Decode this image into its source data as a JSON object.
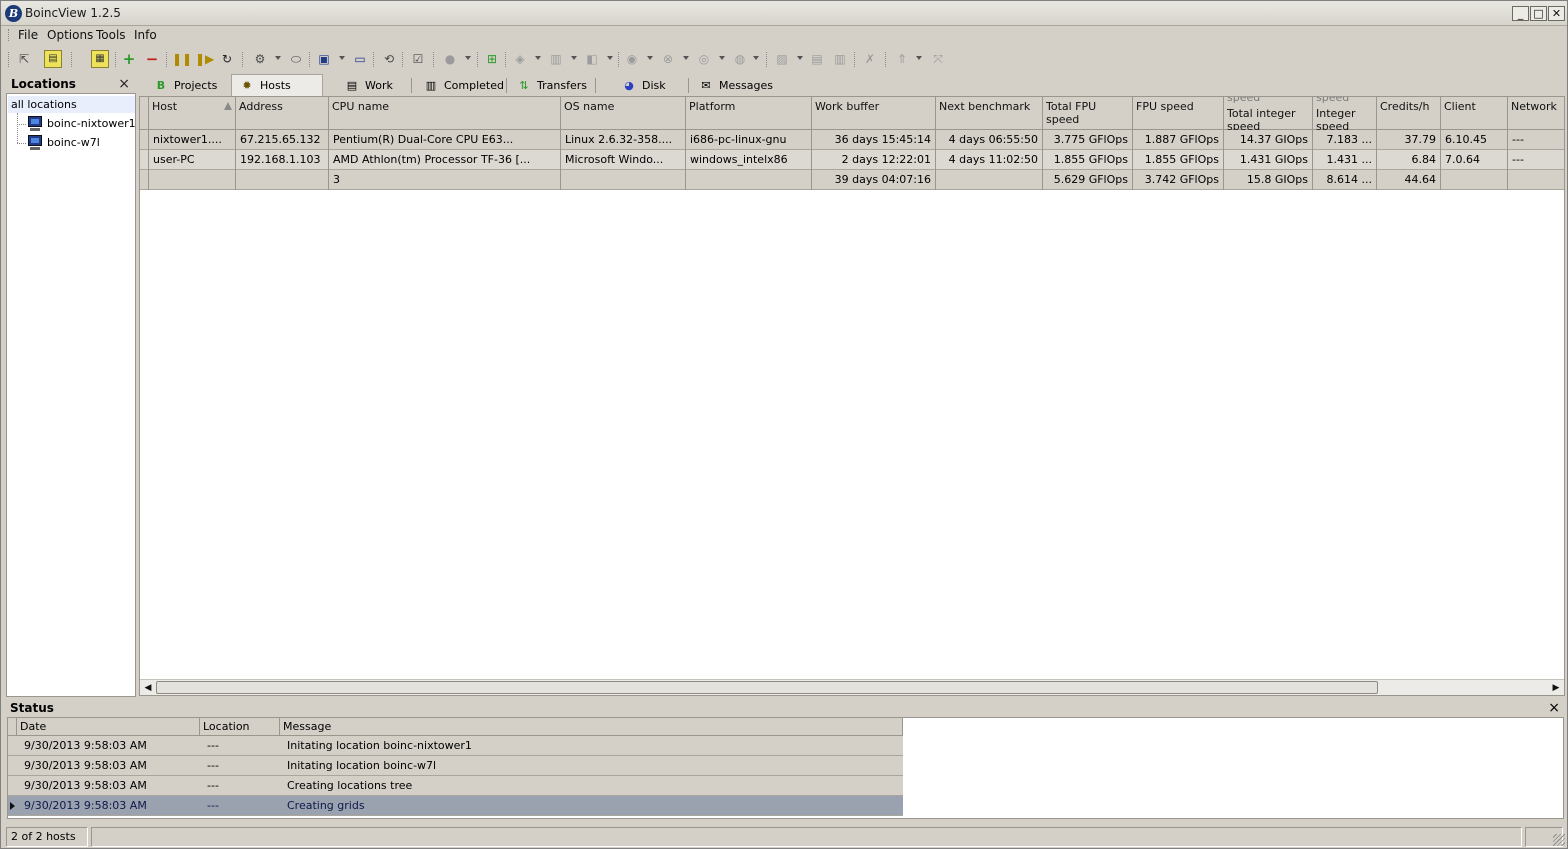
{
  "window": {
    "title": "BoincView 1.2.5",
    "minimize": "_",
    "maximize": "□",
    "close": "✕"
  },
  "menu": [
    "File",
    "Options",
    "Tools",
    "Info"
  ],
  "locations": {
    "title": "Locations",
    "close": "×",
    "all": "all locations",
    "items": [
      "boinc-nixtower1",
      "boinc-w7l"
    ]
  },
  "tabs": [
    {
      "label": "Projects",
      "icon": "boinc-icon"
    },
    {
      "label": "Hosts",
      "icon": "gear-icon"
    },
    {
      "label": "Work",
      "icon": "document-icon"
    },
    {
      "label": "Completed",
      "icon": "documents-icon"
    },
    {
      "label": "Transfers",
      "icon": "transfer-icon"
    },
    {
      "label": "Disk",
      "icon": "pie-icon"
    },
    {
      "label": "Messages",
      "icon": "envelope-icon"
    }
  ],
  "hosts_grid": {
    "columns": [
      {
        "label": "Host"
      },
      {
        "label": "Address"
      },
      {
        "label": "CPU name"
      },
      {
        "label": "OS name"
      },
      {
        "label": "Platform"
      },
      {
        "label": "Work buffer"
      },
      {
        "label": "Next benchmark"
      },
      {
        "label": "Total FPU speed"
      },
      {
        "label": "FPU speed"
      },
      {
        "label": "Total integer speed",
        "top": "speed"
      },
      {
        "label": "Integer speed",
        "top": "speed"
      },
      {
        "label": "Credits/h"
      },
      {
        "label": "Client"
      },
      {
        "label": "Network"
      }
    ],
    "rows": [
      [
        "nixtower1....",
        "67.215.65.132",
        "Pentium(R) Dual-Core  CPU      E63...",
        "Linux 2.6.32-358....",
        "i686-pc-linux-gnu",
        "36 days 15:45:14",
        "4 days 06:55:50",
        "3.775 GFlOps",
        "1.887 GFlOps",
        "14.37 GIOps",
        "7.183 ...",
        "37.79",
        "6.10.45",
        "---"
      ],
      [
        "user-PC",
        "192.168.1.103",
        "AMD Athlon(tm) Processor TF-36 [...",
        "Microsoft Windo...",
        "windows_intelx86",
        "2 days 12:22:01",
        "4 days 11:02:50",
        "1.855 GFlOps",
        "1.855 GFlOps",
        "1.431 GIOps",
        "1.431 ...",
        "6.84",
        "7.0.64",
        "---"
      ],
      [
        "",
        "",
        "3",
        "",
        "",
        "39 days 04:07:16",
        "",
        "5.629 GFlOps",
        "3.742 GFlOps",
        "15.8 GIOps",
        "8.614 ...",
        "44.64",
        "",
        ""
      ]
    ]
  },
  "status": {
    "title": "Status",
    "close": "×",
    "columns": [
      "Date",
      "Location",
      "Message"
    ],
    "rows": [
      [
        "9/30/2013 9:58:03 AM",
        "---",
        "Initating location boinc-nixtower1"
      ],
      [
        "9/30/2013 9:58:03 AM",
        "---",
        "Initating location boinc-w7l"
      ],
      [
        "9/30/2013 9:58:03 AM",
        "---",
        "Creating locations tree"
      ],
      [
        "9/30/2013 9:58:03 AM",
        "---",
        "Creating grids"
      ]
    ]
  },
  "statusbar": {
    "hosts": "2 of 2 hosts"
  },
  "colors": {
    "selected_row": "#9aa2b0",
    "window_bg": "#d4d0c8"
  }
}
